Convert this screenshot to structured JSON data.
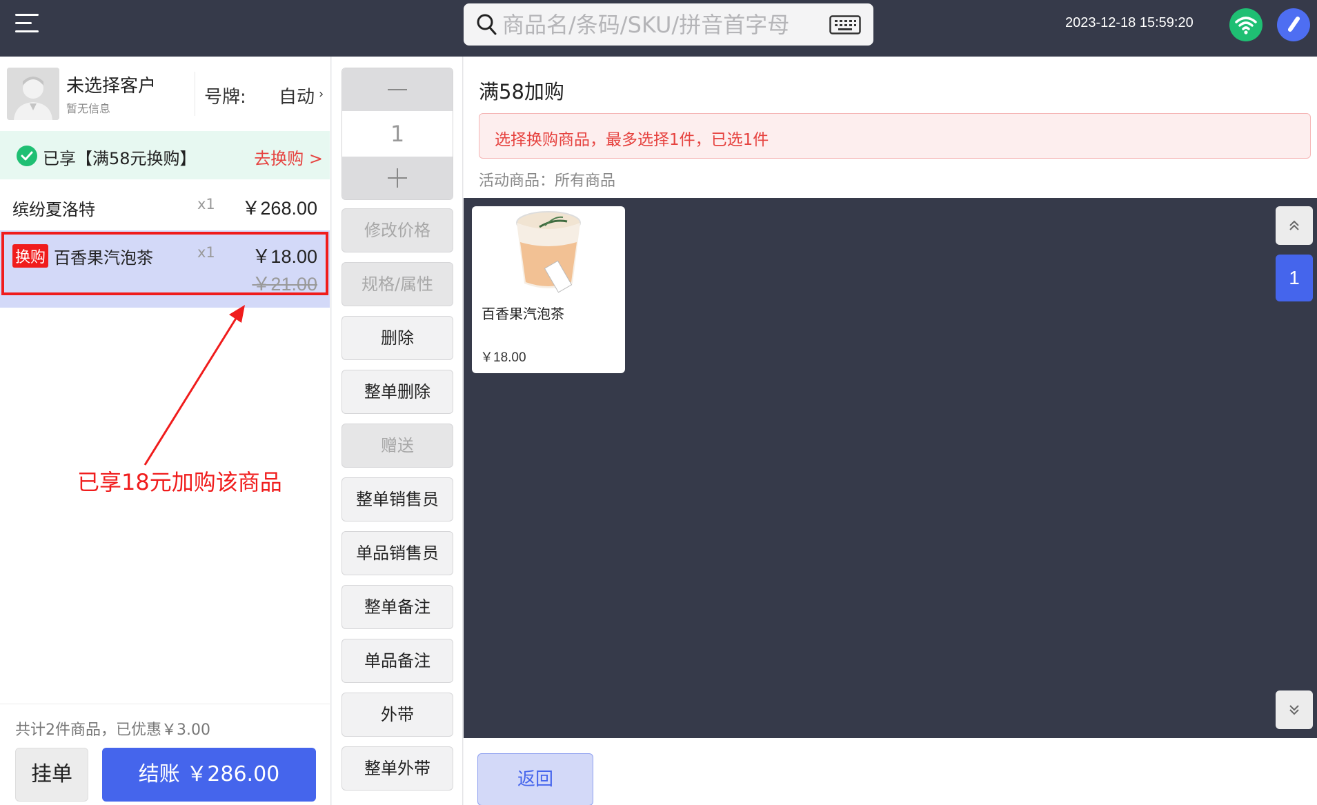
{
  "header": {
    "search_placeholder": "商品名/条码/SKU/拼音首字母",
    "datetime": "2023-12-18 15:59:20",
    "icons": [
      "menu-icon",
      "search-icon",
      "keyboard-icon",
      "wifi-icon",
      "app-logo-icon"
    ],
    "accent_green": "#1fbf73",
    "accent_blue": "#4e6ef2"
  },
  "customer": {
    "name": "未选择客户",
    "info": "暂无信息",
    "plate_label": "号牌:",
    "plate_value": "自动",
    "plate_chevron": "›"
  },
  "promo": {
    "text": "已享【满58元换购】",
    "link": "去换购 >"
  },
  "cart": {
    "items": [
      {
        "name": "缤纷夏洛特",
        "qty": "x1",
        "price": "￥268.00"
      },
      {
        "tag": "换购",
        "name": "百香果汽泡茶",
        "qty": "x1",
        "price": "￥18.00",
        "original_price": "￥21.00"
      }
    ],
    "annotation": "已享18元加购该商品",
    "summary": "共计2件商品，已优惠￥3.00",
    "hold_label": "挂单",
    "checkout_label": "结账 ￥286.00"
  },
  "actions": {
    "quantity": "1",
    "buttons": [
      {
        "label": "修改价格",
        "disabled": true
      },
      {
        "label": "规格/属性",
        "disabled": true
      },
      {
        "label": "删除",
        "disabled": false
      },
      {
        "label": "整单删除",
        "disabled": false
      },
      {
        "label": "赠送",
        "disabled": true
      },
      {
        "label": "整单销售员",
        "disabled": false
      },
      {
        "label": "单品销售员",
        "disabled": false
      },
      {
        "label": "整单备注",
        "disabled": false
      },
      {
        "label": "单品备注",
        "disabled": false
      },
      {
        "label": "外带",
        "disabled": false
      },
      {
        "label": "整单外带",
        "disabled": false
      }
    ]
  },
  "panel": {
    "title": "满58加购",
    "alert": "选择换购商品，最多选择1件，已选1件",
    "scope": "活动商品：所有商品",
    "products": [
      {
        "name": "百香果汽泡茶",
        "price": "￥18.00"
      }
    ],
    "page_number": "1",
    "back_label": "返回"
  }
}
